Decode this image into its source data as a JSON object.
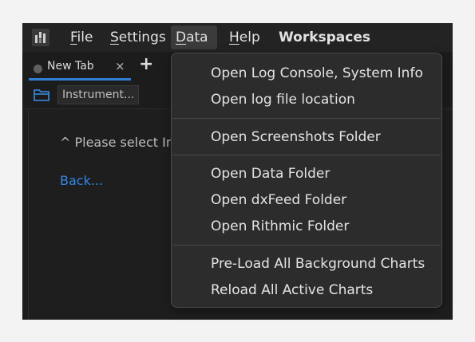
{
  "menubar": {
    "file": {
      "u": "F",
      "rest": "ile"
    },
    "settings": {
      "u": "S",
      "rest": "ettings"
    },
    "data": {
      "u": "D",
      "rest": "ata"
    },
    "help": {
      "u": "H",
      "rest": "elp"
    },
    "workspaces": "Workspaces"
  },
  "tabs": {
    "active_label": "New Tab",
    "close_glyph": "×",
    "add_glyph": "+"
  },
  "toolbar": {
    "instrument_label": "Instrument..."
  },
  "content": {
    "hint": "^ Please select Ins",
    "back_link": "Back..."
  },
  "data_menu": {
    "groups": [
      [
        "Open Log Console, System Info",
        "Open log file location"
      ],
      [
        "Open Screenshots Folder"
      ],
      [
        "Open Data Folder",
        "Open dxFeed Folder",
        "Open Rithmic Folder"
      ],
      [
        "Pre-Load All Background Charts",
        "Reload All Active Charts"
      ]
    ]
  },
  "colors": {
    "accent": "#2f7fd6",
    "link": "#2f87e6",
    "window_bg": "#1e1e1e",
    "menu_bg": "#2c2c2c"
  },
  "icons": {
    "logo": "app-logo-icon",
    "folder": "folder-icon",
    "tab_status": "dot-icon"
  }
}
